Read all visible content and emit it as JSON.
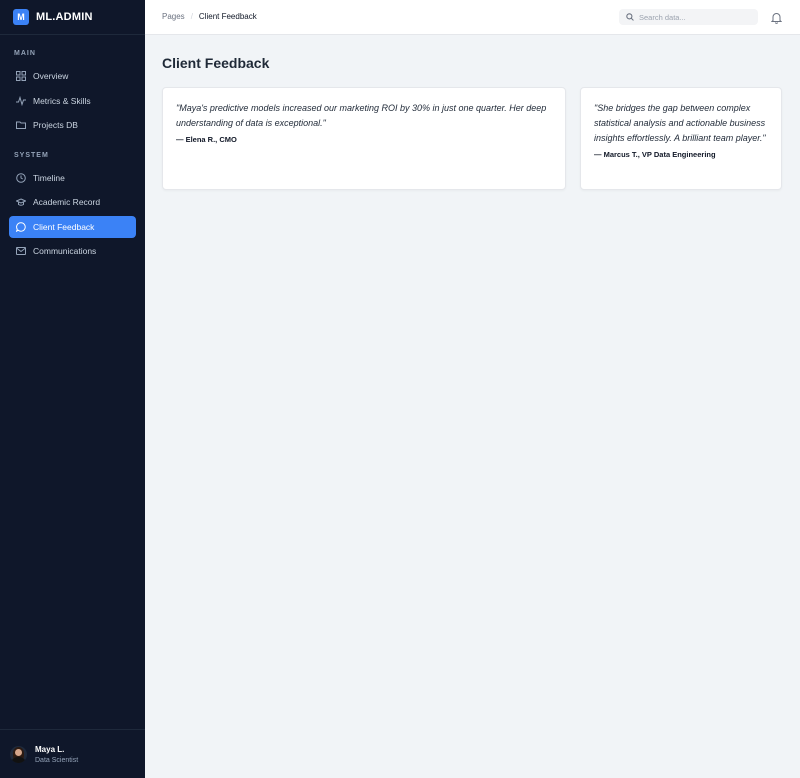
{
  "brand": {
    "logo": "M",
    "name": "ML.ADMIN"
  },
  "sidebar": {
    "sections": [
      {
        "label": "MAIN",
        "items": [
          {
            "label": "Overview",
            "icon": "grid-icon"
          },
          {
            "label": "Metrics & Skills",
            "icon": "activity-icon"
          },
          {
            "label": "Projects DB",
            "icon": "folder-icon"
          }
        ]
      },
      {
        "label": "SYSTEM",
        "items": [
          {
            "label": "Timeline",
            "icon": "clock-icon"
          },
          {
            "label": "Academic Record",
            "icon": "graduation-cap-icon"
          },
          {
            "label": "Client Feedback",
            "icon": "message-circle-icon",
            "active": true
          },
          {
            "label": "Communications",
            "icon": "mail-icon"
          }
        ]
      }
    ]
  },
  "user": {
    "name": "Maya L.",
    "role": "Data Scientist"
  },
  "topbar": {
    "breadcrumb": [
      "Pages",
      "Client Feedback"
    ],
    "search_placeholder": "Search data..."
  },
  "page": {
    "title": "Client Feedback"
  },
  "testimonials": [
    {
      "quote": "\"Maya's predictive models increased our marketing ROI by 30% in just one quarter. Her deep understanding of data is exceptional.\"",
      "author": "— Elena R., CMO"
    },
    {
      "quote": "\"She bridges the gap between complex statistical analysis and actionable business insights effortlessly. A brilliant team player.\"",
      "author": "— Marcus T., VP Data Engineering"
    }
  ],
  "colors": {
    "sidebar_bg": "#0f172a",
    "accent": "#3b82f6",
    "page_bg": "#f1f4f7"
  }
}
